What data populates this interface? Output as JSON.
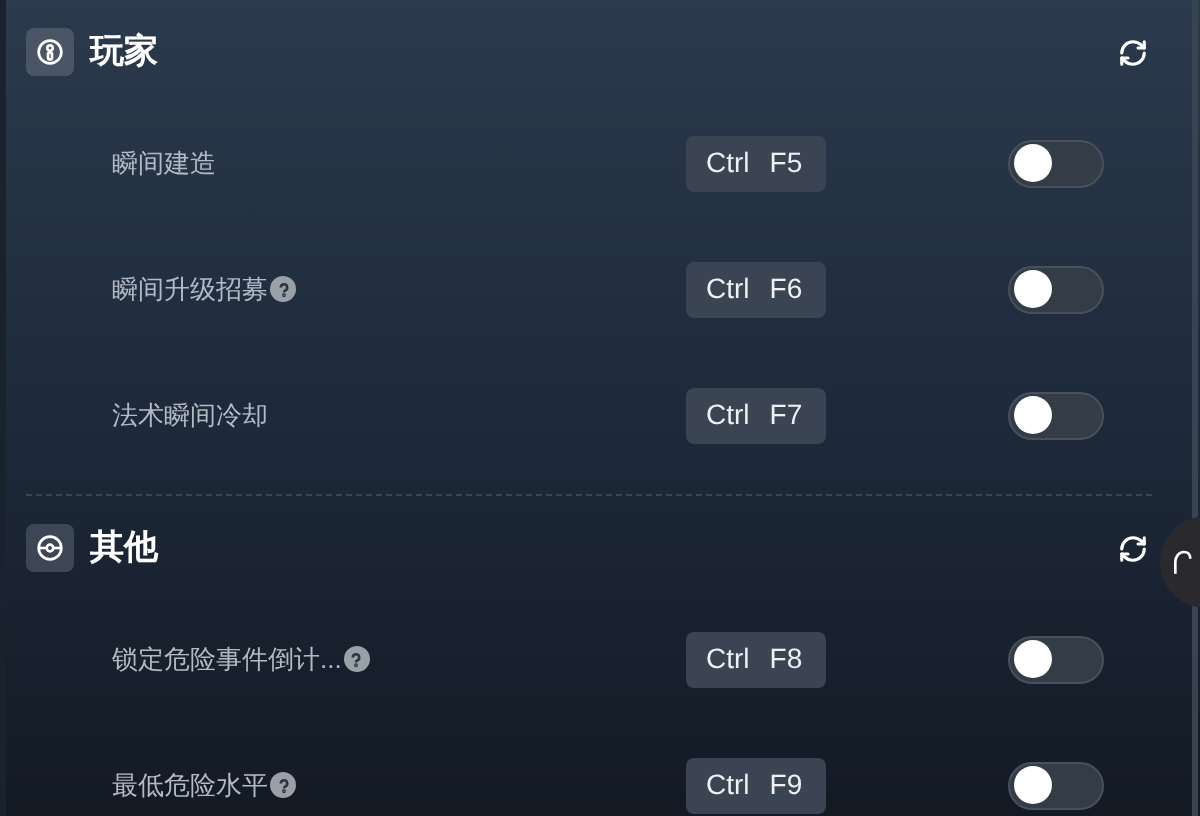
{
  "sections": [
    {
      "title": "玩家",
      "kind": "player",
      "rows": [
        {
          "label": "瞬间建造",
          "help": false,
          "keys": [
            "Ctrl",
            "F5"
          ],
          "on": false
        },
        {
          "label": "瞬间升级招募",
          "help": true,
          "keys": [
            "Ctrl",
            "F6"
          ],
          "on": false
        },
        {
          "label": "法术瞬间冷却",
          "help": false,
          "keys": [
            "Ctrl",
            "F7"
          ],
          "on": false
        }
      ]
    },
    {
      "title": "其他",
      "kind": "other",
      "rows": [
        {
          "label": "锁定危险事件倒计...",
          "help": true,
          "keys": [
            "Ctrl",
            "F8"
          ],
          "on": false
        },
        {
          "label": "最低危险水平",
          "help": true,
          "keys": [
            "Ctrl",
            "F9"
          ],
          "on": false
        }
      ]
    }
  ]
}
